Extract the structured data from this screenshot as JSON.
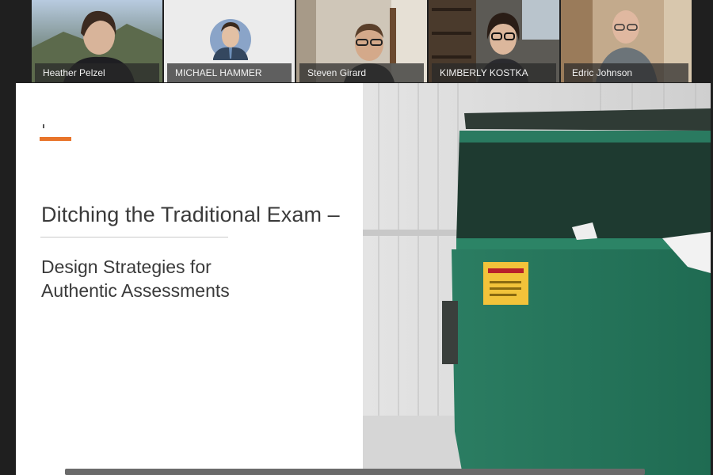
{
  "participants": [
    {
      "name": "Heather Pelzel"
    },
    {
      "name": "MICHAEL HAMMER"
    },
    {
      "name": "Steven Girard"
    },
    {
      "name": "KIMBERLY KOSTKA"
    },
    {
      "name": "Edric Johnson"
    }
  ],
  "slide": {
    "title": "Ditching the Traditional Exam –",
    "subtitle_line1": "Design Strategies for",
    "subtitle_line2": "Authentic Assessments",
    "accent_color": "#e8742a",
    "image": "green-dumpster-photo"
  }
}
